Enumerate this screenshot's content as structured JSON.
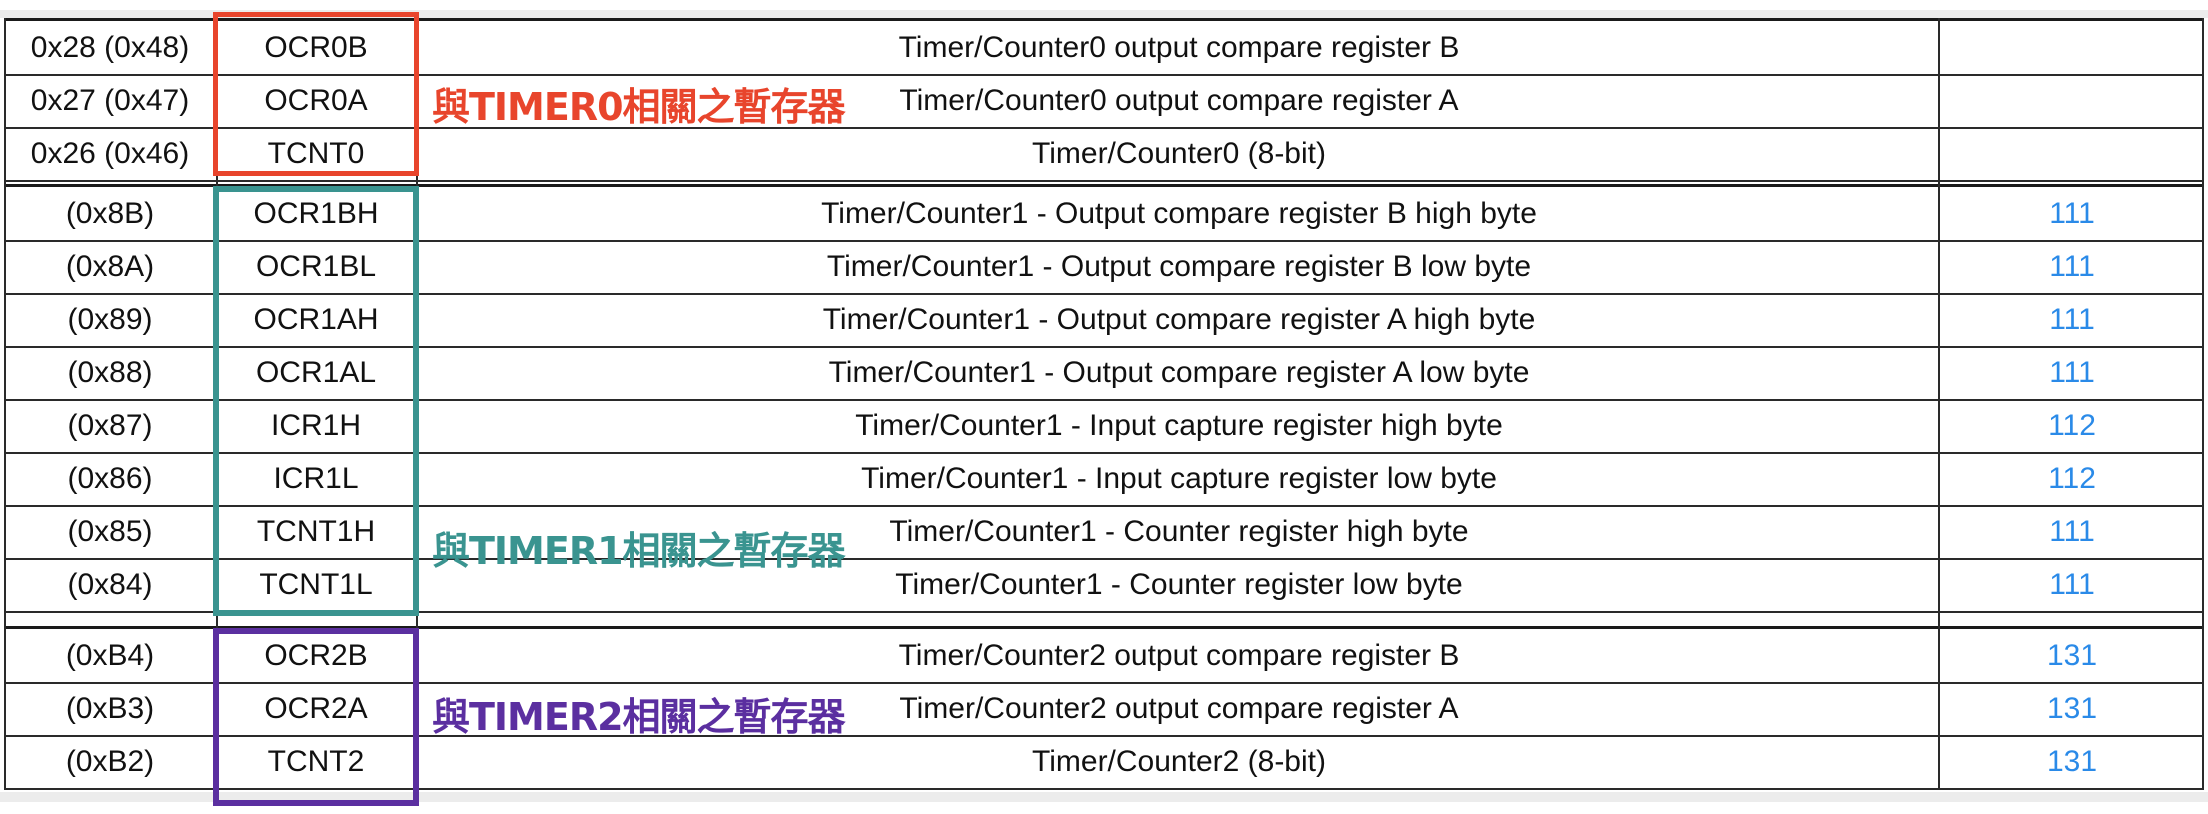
{
  "sections": [
    {
      "rows": [
        {
          "addr": "0x28 (0x48)",
          "name": "OCR0B",
          "desc": "Timer/Counter0 output compare register B",
          "page": ""
        },
        {
          "addr": "0x27 (0x47)",
          "name": "OCR0A",
          "desc": "Timer/Counter0 output compare register A",
          "page": ""
        },
        {
          "addr": "0x26 (0x46)",
          "name": "TCNT0",
          "desc": "Timer/Counter0 (8-bit)",
          "page": ""
        }
      ]
    },
    {
      "rows": [
        {
          "addr": "(0x8B)",
          "name": "OCR1BH",
          "desc": "Timer/Counter1 - Output compare register B high byte",
          "page": "111"
        },
        {
          "addr": "(0x8A)",
          "name": "OCR1BL",
          "desc": "Timer/Counter1 - Output compare register B low byte",
          "page": "111"
        },
        {
          "addr": "(0x89)",
          "name": "OCR1AH",
          "desc": "Timer/Counter1 - Output compare register A high byte",
          "page": "111"
        },
        {
          "addr": "(0x88)",
          "name": "OCR1AL",
          "desc": "Timer/Counter1 - Output compare register A low byte",
          "page": "111"
        },
        {
          "addr": "(0x87)",
          "name": "ICR1H",
          "desc": "Timer/Counter1 - Input capture register high byte",
          "page": "112"
        },
        {
          "addr": "(0x86)",
          "name": "ICR1L",
          "desc": "Timer/Counter1 - Input capture register low byte",
          "page": "112"
        },
        {
          "addr": "(0x85)",
          "name": "TCNT1H",
          "desc": "Timer/Counter1 - Counter register high byte",
          "page": "111"
        },
        {
          "addr": "(0x84)",
          "name": "TCNT1L",
          "desc": "Timer/Counter1 - Counter register low byte",
          "page": "111"
        }
      ]
    },
    {
      "rows": [
        {
          "addr": "(0xB4)",
          "name": "OCR2B",
          "desc": "Timer/Counter2 output compare register B",
          "page": "131"
        },
        {
          "addr": "(0xB3)",
          "name": "OCR2A",
          "desc": "Timer/Counter2 output compare register A",
          "page": "131"
        },
        {
          "addr": "(0xB2)",
          "name": "TCNT2",
          "desc": "Timer/Counter2 (8-bit)",
          "page": "131"
        }
      ]
    }
  ],
  "annotations": [
    {
      "text": "與TIMER0相關之暫存器",
      "color": "#e8452c"
    },
    {
      "text": "與TIMER1相關之暫存器",
      "color": "#3a9490"
    },
    {
      "text": "與TIMER2相關之暫存器",
      "color": "#5b2fa0"
    }
  ]
}
